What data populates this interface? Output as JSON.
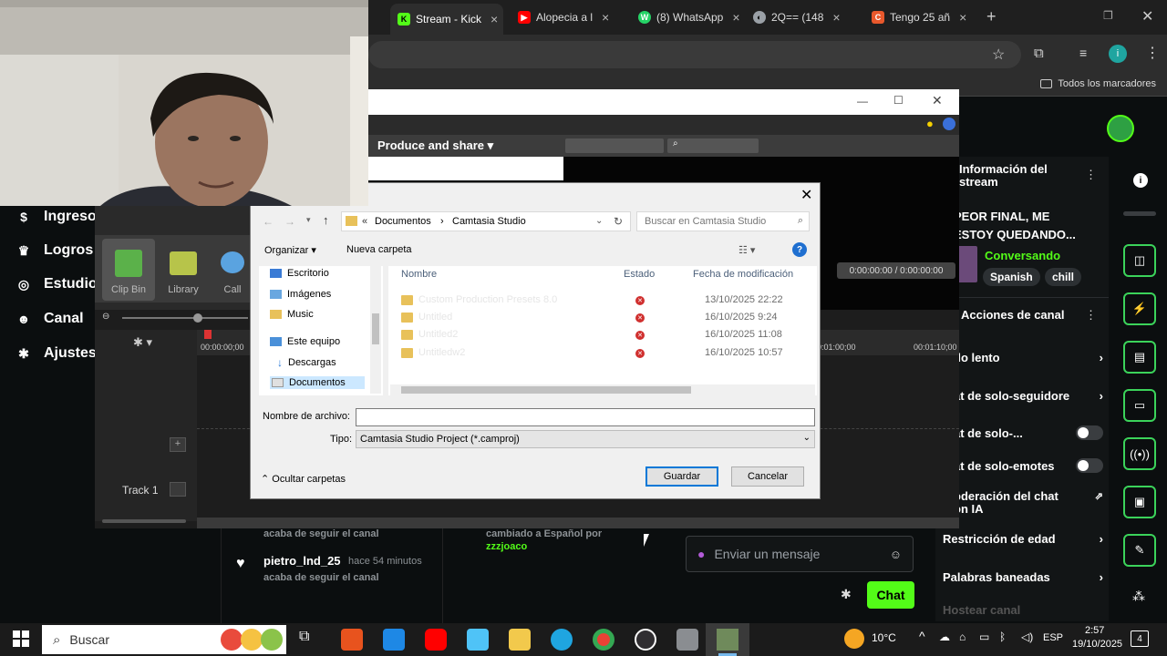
{
  "browser": {
    "tabs": [
      {
        "label": "Stream - Kick",
        "active": true,
        "favicon": "K",
        "color": "#53fc18"
      },
      {
        "label": "Alopecia a l",
        "active": false,
        "favicon": "▶",
        "color": "#ff0000"
      },
      {
        "label": "(8) WhatsApp",
        "active": false,
        "favicon": "W",
        "color": "#25d366"
      },
      {
        "label": "2Q== (148",
        "active": false,
        "favicon": "◐",
        "color": "#9aa0a6"
      },
      {
        "label": "Tengo 25 añ",
        "active": false,
        "favicon": "C",
        "color": "#e8582c"
      }
    ],
    "bookmarks_all": "Todos los marcadores"
  },
  "kick": {
    "nav": [
      "Ingresos",
      "Logros",
      "Estudio",
      "Canal",
      "Ajustes"
    ],
    "stream_info": {
      "header": "Información del stream",
      "title": "PEOR FINAL, ME ESTOY QUEDANDO...",
      "category": "Conversando",
      "tags": [
        "Spanish",
        "chill"
      ]
    },
    "channel_actions": {
      "header": "Acciones de canal",
      "items": [
        "do lento",
        "at de solo-seguidore",
        "at de solo-...",
        "at de solo-emotes",
        "oderación del chat on IA",
        "Restricción de edad",
        "Palabras baneadas",
        "Hostear canal"
      ]
    },
    "activity": [
      {
        "user": "",
        "time": "",
        "text": "acaba de seguir el canal"
      },
      {
        "user": "pietro_lnd_25",
        "time": "hace 54 minutos",
        "text": "acaba de seguir el canal"
      }
    ],
    "language_event": {
      "text": "cambiado a Español por",
      "user": "zzzjoaco"
    },
    "chat": {
      "placeholder": "Enviar un mensaje",
      "send": "Chat"
    }
  },
  "camtasia": {
    "produce_share": "Produce and share",
    "clip_tabs": [
      "Clip Bin",
      "Library",
      "Call"
    ],
    "time_display": "0:00:00:00 / 0:00:00:00",
    "ruler_start": "00:00:00;00",
    "ruler_mid": "0:01:00;00",
    "ruler_end": "00:01:10;00",
    "track": "Track 1"
  },
  "dialog": {
    "breadcrumb": [
      "Documentos",
      "Camtasia Studio"
    ],
    "search_placeholder": "Buscar en Camtasia Studio",
    "organize": "Organizar",
    "new_folder": "Nueva carpeta",
    "nav_items": [
      "Escritorio",
      "Imágenes",
      "Music",
      "Este equipo",
      "Descargas",
      "Documentos"
    ],
    "columns": [
      "Nombre",
      "Estado",
      "Fecha de modificación"
    ],
    "files": [
      {
        "name": "Custom Production Presets 8.0",
        "date": "13/10/2025 22:22"
      },
      {
        "name": "Untitled",
        "date": "16/10/2025 9:24"
      },
      {
        "name": "Untitled2",
        "date": "16/10/2025 11:08"
      },
      {
        "name": "Untitledw2",
        "date": "16/10/2025 10:57"
      }
    ],
    "filename_label": "Nombre de archivo:",
    "filename_value": "",
    "type_label": "Tipo:",
    "type_value": "Camtasia Studio Project (*.camproj)",
    "hide_folders": "Ocultar carpetas",
    "save": "Guardar",
    "cancel": "Cancelar"
  },
  "taskbar": {
    "search": "Buscar",
    "temp": "10°C",
    "lang": "ESP",
    "time": "2:57",
    "date": "19/10/2025",
    "notifications": "4"
  }
}
